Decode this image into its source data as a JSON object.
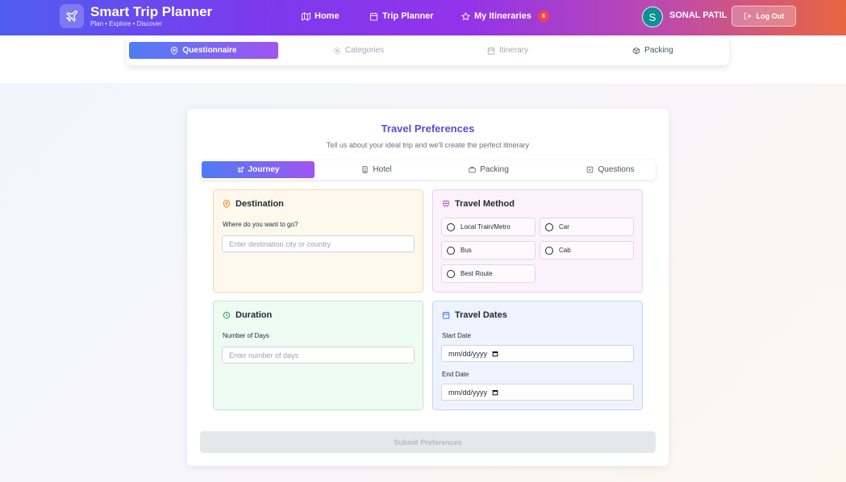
{
  "header": {
    "brand_title": "Smart Trip Planner",
    "brand_subtitle": "Plan • Explore • Discover",
    "nav": [
      {
        "label": "Home",
        "icon": "map-icon"
      },
      {
        "label": "Trip Planner",
        "icon": "calendar-icon"
      },
      {
        "label": "My Itineraries",
        "icon": "star-icon",
        "badge": "8"
      }
    ],
    "user": {
      "initial": "S",
      "name": "SONAL PATIL"
    },
    "logout_label": "Log Out"
  },
  "steps": [
    {
      "label": "Questionnaire",
      "icon": "map-pin-icon",
      "active": true
    },
    {
      "label": "Categories",
      "icon": "gear-icon",
      "active": false
    },
    {
      "label": "Itinerary",
      "icon": "calendar-icon",
      "active": false
    },
    {
      "label": "Packing",
      "icon": "box-icon",
      "active": false
    }
  ],
  "card": {
    "title": "Travel Preferences",
    "subtitle": "Tell us about your ideal trip and we'll create the perfect itinerary",
    "tabs": [
      {
        "label": "Journey",
        "icon": "plane-icon",
        "active": true
      },
      {
        "label": "Hotel",
        "icon": "building-icon",
        "active": false
      },
      {
        "label": "Packing",
        "icon": "briefcase-icon",
        "active": false
      },
      {
        "label": "Questions",
        "icon": "checklist-icon",
        "active": false
      }
    ],
    "destination": {
      "title": "Destination",
      "label": "Where do you want to go?",
      "placeholder": "Enter destination city or country"
    },
    "travel_method": {
      "title": "Travel Method",
      "options": [
        "Local Train/Metro",
        "Car",
        "Bus",
        "Cab",
        "Best Route"
      ]
    },
    "duration": {
      "title": "Duration",
      "label": "Number of Days",
      "placeholder": "Enter number of days"
    },
    "travel_dates": {
      "title": "Travel Dates",
      "start_label": "Start Date",
      "start_value": "mm/dd/yyyy",
      "end_label": "End Date",
      "end_value": "mm/dd/yyyy"
    },
    "submit_label": "Submit Preferences"
  },
  "colors": {
    "accent": "#5b4bd6",
    "destination_bg": "#fff8ec",
    "travel_method_bg": "#fbf2fb",
    "duration_bg": "#eefbf3",
    "travel_dates_bg": "#eef3fd"
  }
}
